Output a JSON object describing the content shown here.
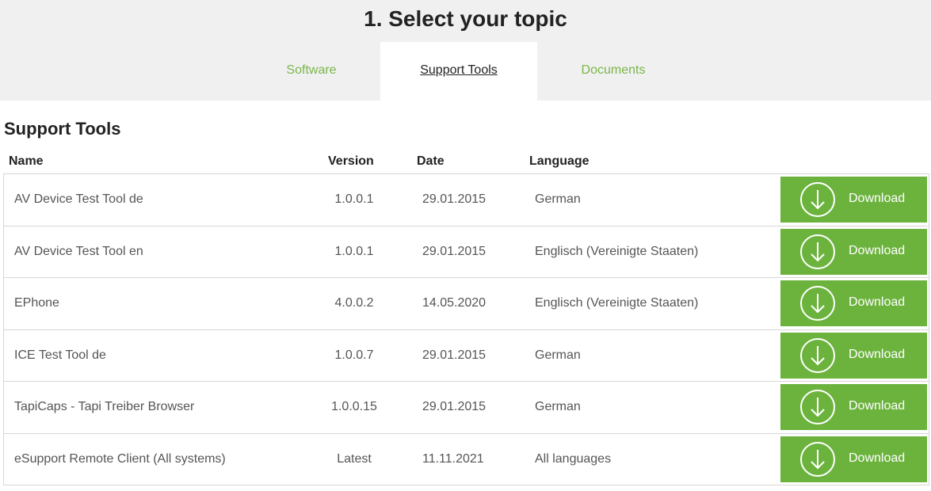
{
  "header": {
    "title": "1. Select your topic",
    "tabs": [
      {
        "label": "Software",
        "active": false
      },
      {
        "label": "Support Tools",
        "active": true
      },
      {
        "label": "Documents",
        "active": false
      }
    ]
  },
  "section": {
    "title": "Support Tools",
    "columns": {
      "name": "Name",
      "version": "Version",
      "date": "Date",
      "language": "Language"
    },
    "rows": [
      {
        "name": "AV Device Test Tool de",
        "version": "1.0.0.1",
        "date": "29.01.2015",
        "language": "German",
        "action": "Download"
      },
      {
        "name": "AV Device Test Tool en",
        "version": "1.0.0.1",
        "date": "29.01.2015",
        "language": "Englisch (Vereinigte Staaten)",
        "action": "Download"
      },
      {
        "name": "EPhone",
        "version": "4.0.0.2",
        "date": "14.05.2020",
        "language": "Englisch (Vereinigte Staaten)",
        "action": "Download"
      },
      {
        "name": "ICE Test Tool de",
        "version": "1.0.0.7",
        "date": "29.01.2015",
        "language": "German",
        "action": "Download"
      },
      {
        "name": "TapiCaps - Tapi Treiber Browser",
        "version": "1.0.0.15",
        "date": "29.01.2015",
        "language": "German",
        "action": "Download"
      },
      {
        "name": "eSupport Remote Client (All systems)",
        "version": "Latest",
        "date": "11.11.2021",
        "language": "All languages",
        "action": "Download"
      }
    ]
  },
  "icons": {
    "download": "download-arrow-circle-icon"
  },
  "colors": {
    "accent": "#6cb33e",
    "tab_link": "#7ab648",
    "band": "#f0f0f0"
  }
}
